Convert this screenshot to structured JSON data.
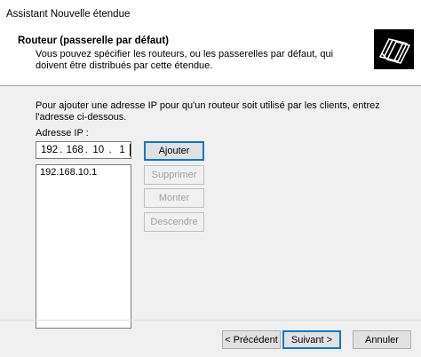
{
  "window": {
    "title": "Assistant Nouvelle étendue"
  },
  "header": {
    "title": "Routeur (passerelle par défaut)",
    "description": "Vous pouvez spécifier les routeurs, ou les passerelles par défaut, qui doivent être distribués par cette étendue.",
    "icon": "folder-stack-icon"
  },
  "main": {
    "instructions": "Pour ajouter une adresse IP pour qu'un routeur soit utilisé par les clients, entrez l'adresse ci-dessous.",
    "ip_label": "Adresse IP :",
    "ip_octets": [
      "192",
      "168",
      "10",
      "1"
    ],
    "ip_separator": ".",
    "router_list": [
      "192.168.10.1"
    ],
    "buttons": {
      "add": "Ajouter",
      "remove": "Supprimer",
      "up": "Monter",
      "down": "Descendre"
    }
  },
  "footer": {
    "back": "< Précédent",
    "next": "Suivant >",
    "cancel": "Annuler"
  },
  "colors": {
    "focus_border": "#0078d7",
    "disabled_text": "#a0a0a0",
    "dialog_bg": "#f0f0f0"
  }
}
